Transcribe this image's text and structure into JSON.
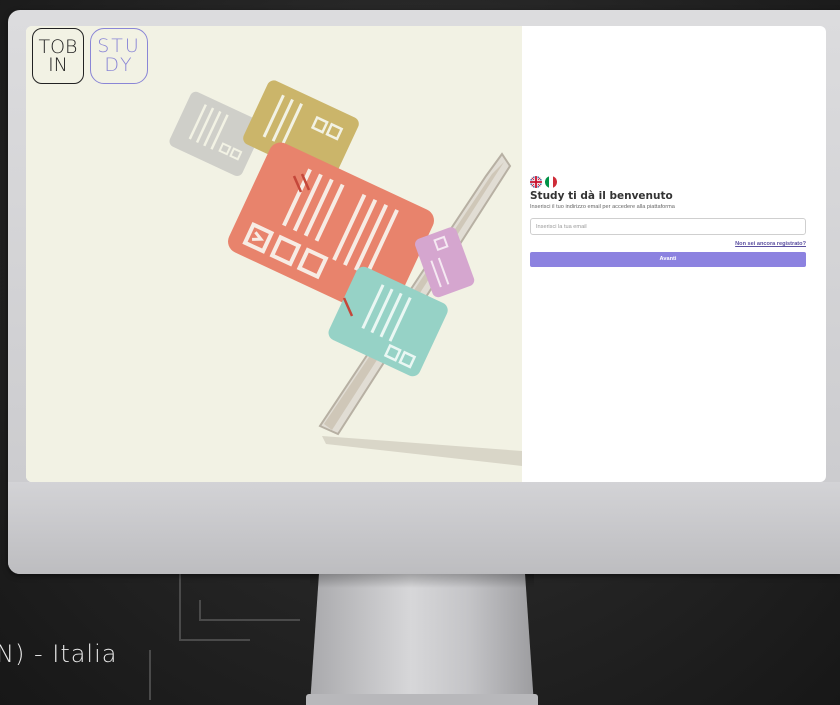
{
  "background": {
    "location_text": "N) - Italia"
  },
  "brand": {
    "logo_tobin": "TOB\nIN",
    "logo_study": "STU\nDY",
    "accent_color": "#8c82e0"
  },
  "login": {
    "languages": [
      {
        "name": "English",
        "icon": "uk-flag-icon"
      },
      {
        "name": "Italiano",
        "icon": "italy-flag-icon"
      }
    ],
    "title": "Study ti dà il benvenuto",
    "subtitle": "Inserisci il tuo indirizzo email per accedere alla piattaforma",
    "email_placeholder": "Inserisci la tua email",
    "email_value": "",
    "register_link": "Non sei ancora registrato?",
    "submit_label": "Avanti"
  }
}
